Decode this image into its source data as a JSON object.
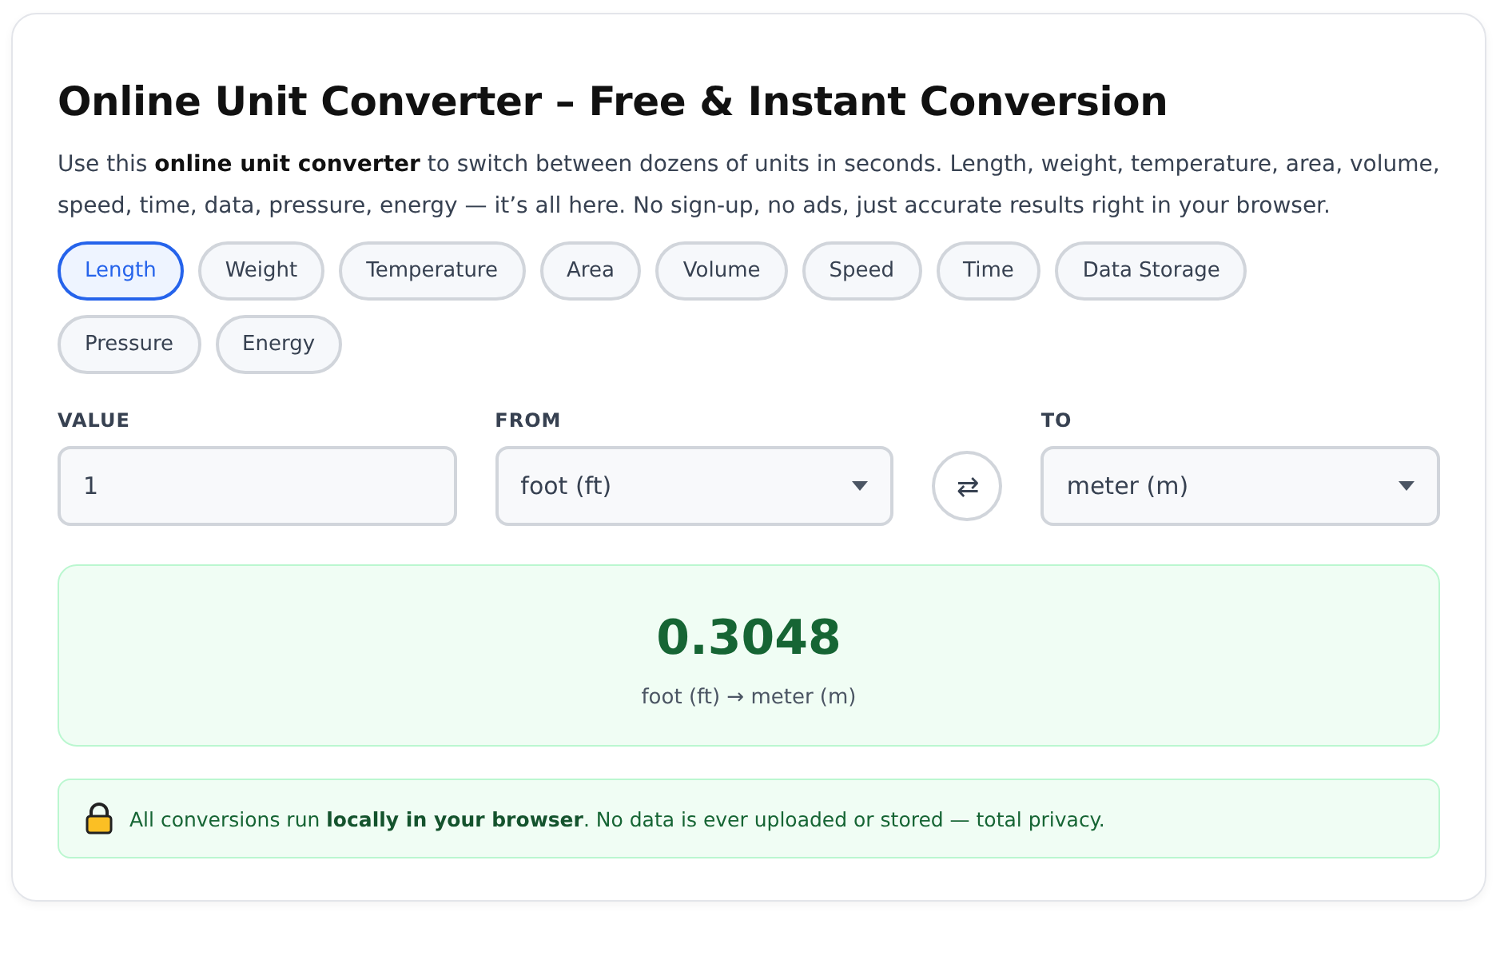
{
  "title": "Online Unit Converter – Free & Instant Conversion",
  "intro": "Use this **online unit converter** to switch between dozens of units in seconds. Length, weight, temperature, area, volume, speed, time, data, pressure, energy — it’s all here. No sign-up, no ads, just accurate results right in your browser.",
  "categories": [
    {
      "label": "Length",
      "selected": true
    },
    {
      "label": "Weight",
      "selected": false
    },
    {
      "label": "Temperature",
      "selected": false
    },
    {
      "label": "Area",
      "selected": false
    },
    {
      "label": "Volume",
      "selected": false
    },
    {
      "label": "Speed",
      "selected": false
    },
    {
      "label": "Time",
      "selected": false
    },
    {
      "label": "Data Storage",
      "selected": false
    },
    {
      "label": "Pressure",
      "selected": false
    },
    {
      "label": "Energy",
      "selected": false
    }
  ],
  "value_field": {
    "label": "VALUE",
    "value": "1"
  },
  "from_field": {
    "label": "FROM",
    "value": "foot (ft)"
  },
  "swap_button": {
    "label": "⇄"
  },
  "to_field": {
    "label": "TO",
    "value": "meter (m)"
  },
  "result": {
    "value": "0.3048",
    "caption": "foot (ft) → meter (m)"
  },
  "privacy_note": "All conversions run **locally in your browser**. No data is ever uploaded or stored — total privacy."
}
